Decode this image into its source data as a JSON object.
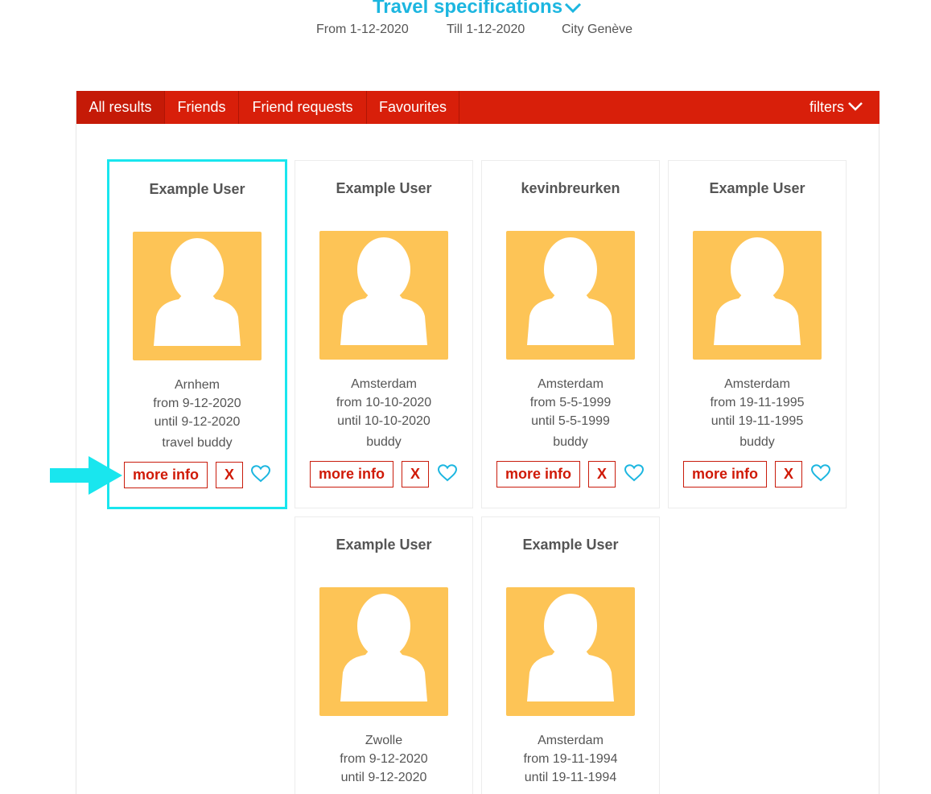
{
  "header": {
    "title": "Travel specifications",
    "from_label": "From",
    "from_value": "1-12-2020",
    "till_label": "Till",
    "till_value": "1-12-2020",
    "city_label": "City",
    "city_value": "Genève"
  },
  "tabs": [
    {
      "label": "All results",
      "active": true
    },
    {
      "label": "Friends",
      "active": false
    },
    {
      "label": "Friend requests",
      "active": false
    },
    {
      "label": "Favourites",
      "active": false
    }
  ],
  "filters_label": "filters",
  "cards": [
    {
      "name": "Example User",
      "city": "Arnhem",
      "from": "from 9-12-2020",
      "until": "until 9-12-2020",
      "role": "travel buddy",
      "more": "more info",
      "remove": "X"
    },
    {
      "name": "Example User",
      "city": "Amsterdam",
      "from": "from 10-10-2020",
      "until": "until 10-10-2020",
      "role": "buddy",
      "more": "more info",
      "remove": "X"
    },
    {
      "name": "kevinbreurken",
      "city": "Amsterdam",
      "from": "from 5-5-1999",
      "until": "until 5-5-1999",
      "role": "buddy",
      "more": "more info",
      "remove": "X"
    },
    {
      "name": "Example User",
      "city": "Amsterdam",
      "from": "from 19-11-1995",
      "until": "until 19-11-1995",
      "role": "buddy",
      "more": "more info",
      "remove": "X"
    },
    {
      "name": "Example User",
      "city": "Zwolle",
      "from": "from 9-12-2020",
      "until": "until 9-12-2020",
      "role": "",
      "more": "",
      "remove": ""
    },
    {
      "name": "Example User",
      "city": "Amsterdam",
      "from": "from 19-11-1994",
      "until": "until 19-11-1994",
      "role": "",
      "more": "",
      "remove": ""
    }
  ],
  "colors": {
    "accent": "#1cb6e0",
    "tabbar": "#d81f0a",
    "avatar_bg": "#fdc456",
    "highlight": "#19e6ee",
    "button": "#d01a07"
  },
  "icons": [
    "chevron-down-icon",
    "user-avatar-icon",
    "heart-icon",
    "arrow-right-icon"
  ]
}
